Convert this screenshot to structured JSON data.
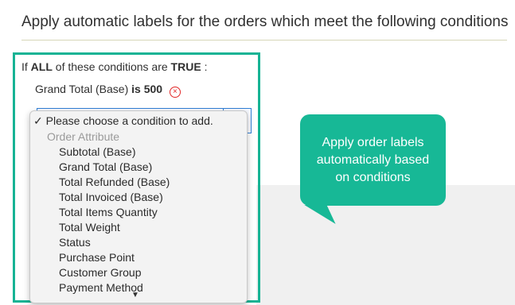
{
  "header": {
    "title": "Apply automatic labels for the orders which meet the following conditions"
  },
  "conditions": {
    "prefix": "If",
    "aggregator": "ALL",
    "middle": "of these conditions are",
    "value": "TRUE",
    "suffix": ":"
  },
  "rule": {
    "attribute": "Grand Total (Base)",
    "operator": "is",
    "value": "500"
  },
  "dropdown": {
    "selected_label": "✓ Please choose a condition to add.",
    "group_label": "Order Attribute",
    "options": [
      "Subtotal (Base)",
      "Grand Total (Base)",
      "Total Refunded (Base)",
      "Total Invoiced (Base)",
      "Total Items Quantity",
      "Total Weight",
      "Status",
      "Purchase Point",
      "Customer Group",
      "Payment Method"
    ]
  },
  "callout": {
    "text": "Apply order labels automatically based on conditions"
  },
  "colors": {
    "highlight": "#16b394",
    "callout": "#17b896",
    "remove": "#e22626"
  }
}
